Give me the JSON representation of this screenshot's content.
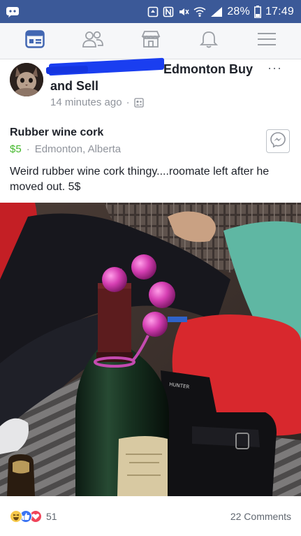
{
  "status_bar": {
    "battery_percent": "28%",
    "time": "17:49",
    "icons": [
      "messenger-status-icon",
      "alarm-icon",
      "nfc-icon",
      "mute-icon",
      "wifi-icon",
      "signal-icon",
      "battery-icon"
    ]
  },
  "nav": {
    "items": [
      {
        "name": "news-feed",
        "icon": "newsfeed-icon",
        "active": true
      },
      {
        "name": "friends",
        "icon": "friends-icon",
        "active": false
      },
      {
        "name": "marketplace",
        "icon": "marketplace-icon",
        "active": false
      },
      {
        "name": "notifications",
        "icon": "bell-icon",
        "active": false
      },
      {
        "name": "menu",
        "icon": "hamburger-icon",
        "active": false
      }
    ]
  },
  "post": {
    "group_name_line1": "Edmonton Buy",
    "group_name_line2": "and Sell",
    "more_label": "···",
    "timestamp": "14 minutes ago",
    "separator": "·",
    "audience_icon": "group-icon"
  },
  "listing": {
    "title": "Rubber wine cork",
    "price": "$5",
    "separator": "·",
    "location": "Edmonton, Alberta",
    "description": "Weird rubber wine cork thingy....roomate left after he moved out. 5$",
    "message_icon": "messenger-icon"
  },
  "footer": {
    "reaction_count": "51",
    "comments_label": "22 Comments",
    "reactions": [
      "haha-icon",
      "like-icon",
      "love-icon"
    ]
  },
  "colors": {
    "brand": "#3b5998",
    "nav_active": "#4267b2",
    "price": "#42b72a",
    "redaction": "#1a3ef0"
  }
}
